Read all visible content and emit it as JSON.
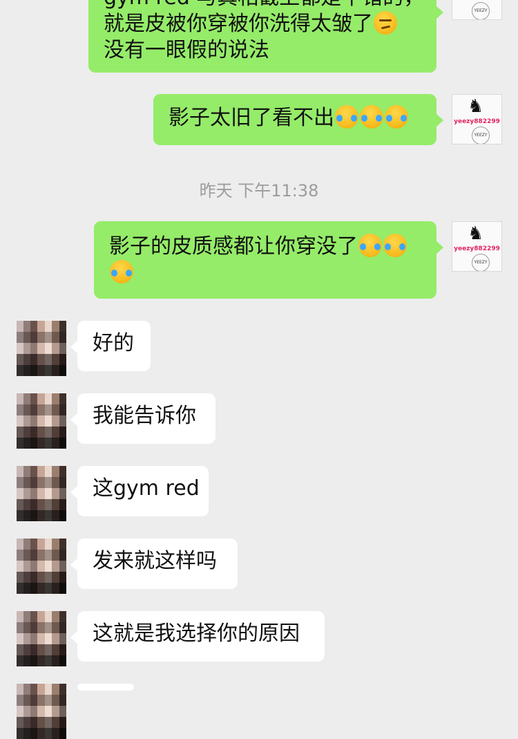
{
  "messages": [
    {
      "side": "out",
      "lines": [
        "gym red 与真相截上都是不错的，",
        "就是皮被你穿被你洗得太皱了",
        "没有一眼假的说法"
      ],
      "emoji_line1": "smirk"
    },
    {
      "side": "out",
      "text": "影子太旧了看不出"
    },
    {
      "side": "out",
      "text": "影子的皮质感都让你穿没了"
    },
    {
      "side": "in",
      "text": "好的"
    },
    {
      "side": "in",
      "text": "我能告诉你"
    },
    {
      "side": "in",
      "text": "这gym red"
    },
    {
      "side": "in",
      "text": "发来就这样吗"
    },
    {
      "side": "in",
      "text": "这就是我选择你的原因"
    }
  ],
  "timestamp": "昨天 下午11:38",
  "self_avatar": {
    "handle": "yeezy882299",
    "badge": "YEEZY"
  },
  "icons": {
    "self_avatar": "jumpman-yeezy-avatar-icon",
    "peer_avatar": "pixelated-cat-avatar-icon",
    "laugh": "face-with-tears-of-joy-icon",
    "smirk": "smirking-face-icon"
  },
  "colors": {
    "background": "#ededed",
    "outgoing_bubble": "#95ec69",
    "incoming_bubble": "#ffffff",
    "timestamp": "#9c9c9c"
  }
}
